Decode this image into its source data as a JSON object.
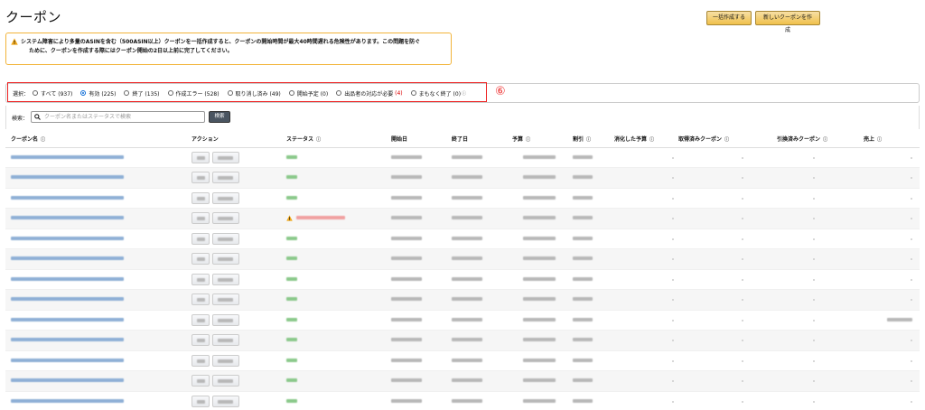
{
  "page": {
    "title": "クーポン",
    "bulk_create_label": "一括作成する",
    "new_coupon_label": "新しいクーポンを作成"
  },
  "warning": {
    "line1": "システム障害により多量のASINを含む（500ASIN以上）クーポンを一括作成すると、クーポンの開始時間が最大40時間遅れる危険性があります。この問題を防ぐ",
    "line2": "ために、クーポンを作成する際にはクーポン開始の2日以上前に完了してください。"
  },
  "filter": {
    "label": "選択：",
    "options": [
      {
        "label": "すべて (937)",
        "checked": false
      },
      {
        "label": "有効 (225)",
        "checked": true
      },
      {
        "label": "終了 (135)",
        "checked": false
      },
      {
        "label": "作成エラー (528)",
        "checked": false
      },
      {
        "label": "取り消し済み (49)",
        "checked": false
      },
      {
        "label": "開始予定 (0)",
        "checked": false
      },
      {
        "label": "出品者の対応が必要",
        "count": "(4)",
        "checked": false
      },
      {
        "label": "まもなく終了 (0)",
        "checked": false
      }
    ],
    "annotation": "⑥"
  },
  "search": {
    "label": "検索：",
    "placeholder": "クーポン名またはステータスで検索",
    "button_label": "検索"
  },
  "table": {
    "headers": {
      "name": "クーポン名",
      "action": "アクション",
      "status": "ステータス",
      "start": "開始日",
      "end": "終了日",
      "budget": "予算",
      "discount": "割引",
      "spent": "消化した予算",
      "clipped": "取得済みクーポン",
      "redeemed": "引換済みクーポン",
      "sales": "売上"
    },
    "row_count": 13
  },
  "colors": {
    "accent_button": "#f0c14b",
    "warning_border": "#f2b43a",
    "highlight_border": "#ee2222",
    "link_blur": "#8fb0d6",
    "status_ok": "#8bc98b",
    "status_error": "#f0a0a0"
  }
}
